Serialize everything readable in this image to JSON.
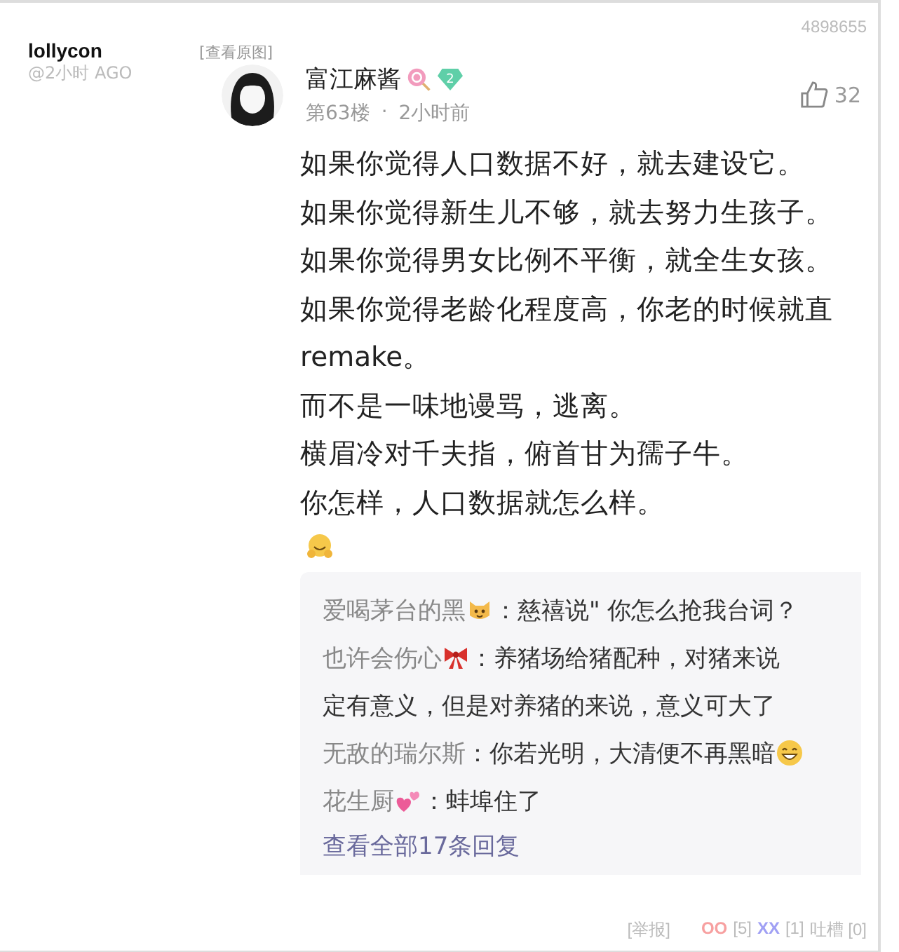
{
  "post": {
    "author": "lollycon",
    "time": "@2小时 AGO",
    "view_original": "[查看原图]",
    "id": "4898655"
  },
  "comment": {
    "name": "富江麻酱",
    "level": "2",
    "floor": "第63楼",
    "separator": "·",
    "time": "2小时前",
    "likes": "32",
    "lines": [
      "如果你觉得人口数据不好，就去建设它。",
      "如果你觉得新生儿不够，就去努力生孩子。",
      "如果你觉得男女比例不平衡，就全生女孩。",
      "如果你觉得老龄化程度高，你老的时候就直",
      "remake。",
      "而不是一味地谩骂，逃离。",
      "横眉冷对千夫指，俯首甘为孺子牛。",
      "你怎样，人口数据就怎么样。"
    ],
    "replies": [
      {
        "name": "爱喝茅台的黑",
        "name_icon": {
          "kind": "cat"
        },
        "text": "：慈禧说\" 你怎么抢我台词？"
      },
      {
        "name": "也许会伤心",
        "name_icon": {
          "kind": "bow"
        },
        "text": "：养猪场给猪配种，对猪来说",
        "continuation": "定有意义，但是对养猪的来说，意义可大了"
      },
      {
        "name": "无敌的瑞尔斯",
        "text": "：你若光明，大清便不再黑暗",
        "trailing_icon": {
          "kind": "grin"
        }
      },
      {
        "name": "花生厨",
        "name_icon": {
          "kind": "hearts"
        },
        "text": "：蚌埠住了"
      }
    ],
    "view_all": "查看全部17条回复"
  },
  "footer": {
    "report": "[举报]",
    "oo": "OO",
    "oo_count": "[5]",
    "xx": "XX",
    "xx_count": "[1]",
    "tucao": "吐槽 [0]"
  }
}
